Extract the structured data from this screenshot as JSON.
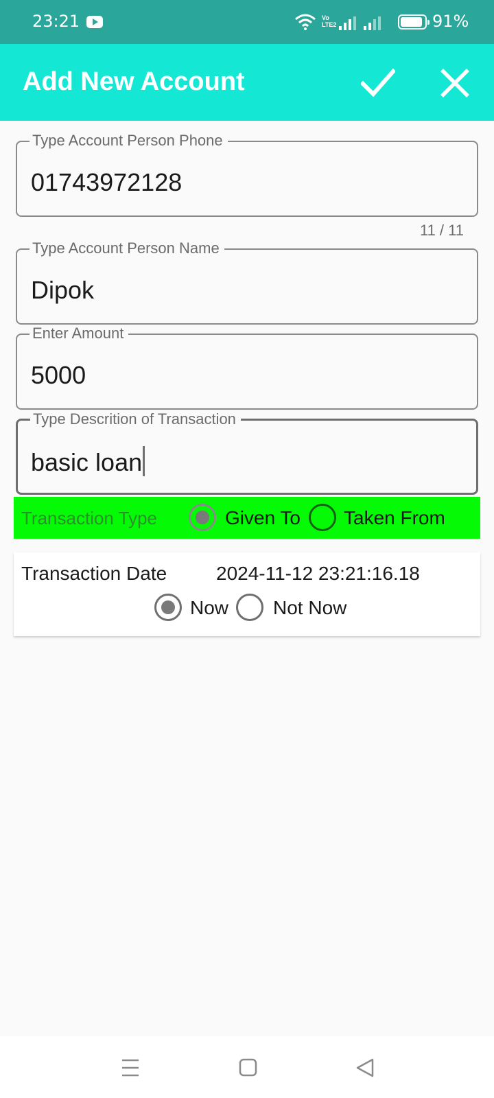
{
  "status_bar": {
    "time": "23:21",
    "battery": "91%",
    "icons": [
      "youtube-icon",
      "wifi-icon",
      "volte-icon",
      "signal-icon",
      "battery-icon"
    ],
    "battery_level": 0.91
  },
  "app_bar": {
    "title": "Add New Account",
    "actions": [
      "check-icon",
      "close-icon"
    ]
  },
  "form": {
    "phone": {
      "label": "Type Account Person Phone",
      "value": "01743972128",
      "counter": "11 / 11"
    },
    "name": {
      "label": "Type Account Person Name",
      "value": "Dipok"
    },
    "amount": {
      "label": "Enter Amount",
      "value": "5000"
    },
    "description": {
      "label": "Type Descrition of Transaction",
      "value": "basic loan"
    }
  },
  "transaction_type": {
    "label": "Transaction Type",
    "options": [
      "Given To",
      "Taken From"
    ],
    "selected": "Given To"
  },
  "transaction_date": {
    "label": "Transaction Date",
    "value": "2024-11-12 23:21:16.18",
    "options": [
      "Now",
      "Not Now"
    ],
    "selected": "Now"
  },
  "colors": {
    "status_bar": "#2aa69a",
    "app_bar": "#14e8d4",
    "type_bar": "#05fb05",
    "background": "#fafafa"
  },
  "nav_bar": {
    "icons": [
      "menu-icon",
      "home-icon",
      "back-icon"
    ]
  }
}
